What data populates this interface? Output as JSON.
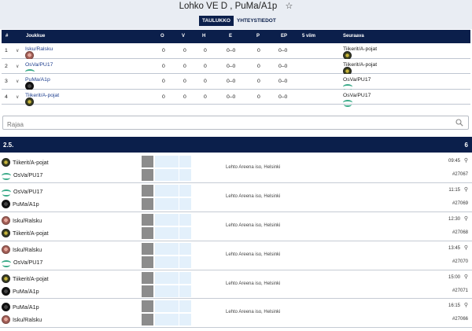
{
  "header": {
    "title": "Lohko VE D , PuMa/A1p",
    "star_icon": "star-outline-icon",
    "tabs": [
      {
        "label": "TAULUKKO",
        "active": true
      },
      {
        "label": "YHTEYSTIEDOT",
        "active": false
      }
    ]
  },
  "standings": {
    "columns": [
      "#",
      "Joukkue",
      "O",
      "V",
      "H",
      "E",
      "P",
      "EP",
      "5 viim",
      "Seuraava"
    ],
    "rows": [
      {
        "pos": "1",
        "team": "Isku/Ralsku",
        "logo": "isku",
        "o": "0",
        "v": "0",
        "h": "0",
        "e": "0–0",
        "p": "0",
        "ep": "0–0",
        "next": "Tiikerit/A-pojat",
        "next_logo": "tiikerit"
      },
      {
        "pos": "2",
        "team": "OsVa/PU17",
        "logo": "osva",
        "o": "0",
        "v": "0",
        "h": "0",
        "e": "0–0",
        "p": "0",
        "ep": "0–0",
        "next": "Tiikerit/A-pojat",
        "next_logo": "tiikerit"
      },
      {
        "pos": "3",
        "team": "PuMa/A1p",
        "logo": "puma",
        "o": "0",
        "v": "0",
        "h": "0",
        "e": "0–0",
        "p": "0",
        "ep": "0–0",
        "next": "OsVa/PU17",
        "next_logo": "osva"
      },
      {
        "pos": "4",
        "team": "Tiikerit/A-pojat",
        "logo": "tiikerit",
        "o": "0",
        "v": "0",
        "h": "0",
        "e": "0–0",
        "p": "0",
        "ep": "0–0",
        "next": "OsVa/PU17",
        "next_logo": "osva"
      }
    ]
  },
  "filter": {
    "placeholder": "Rajaa",
    "icon": "search-icon"
  },
  "round": {
    "name": "2.5.",
    "count": "6"
  },
  "matches": [
    {
      "home": "Tiikerit/A-pojat",
      "home_logo": "tiikerit",
      "away": "OsVa/PU17",
      "away_logo": "osva",
      "venue": "Lehto Areena iso, Helsinki",
      "time": "09:45",
      "id": "#27067"
    },
    {
      "home": "OsVa/PU17",
      "home_logo": "osva",
      "away": "PuMa/A1p",
      "away_logo": "puma",
      "venue": "Lehto Areena iso, Helsinki",
      "time": "11:15",
      "id": "#27069"
    },
    {
      "home": "Isku/Ralsku",
      "home_logo": "isku",
      "away": "Tiikerit/A-pojat",
      "away_logo": "tiikerit",
      "venue": "Lehto Areena iso, Helsinki",
      "time": "12:30",
      "id": "#27068"
    },
    {
      "home": "Isku/Ralsku",
      "home_logo": "isku",
      "away": "OsVa/PU17",
      "away_logo": "osva",
      "venue": "Lehto Areena iso, Helsinki",
      "time": "13:45",
      "id": "#27070"
    },
    {
      "home": "Tiikerit/A-pojat",
      "home_logo": "tiikerit",
      "away": "PuMa/A1p",
      "away_logo": "puma",
      "venue": "Lehto Areena iso, Helsinki",
      "time": "15:00",
      "id": "#27071"
    },
    {
      "home": "PuMa/A1p",
      "home_logo": "puma",
      "away": "Isku/Ralsku",
      "away_logo": "isku",
      "venue": "Lehto Areena iso, Helsinki",
      "time": "16:15",
      "id": "#27066"
    }
  ]
}
